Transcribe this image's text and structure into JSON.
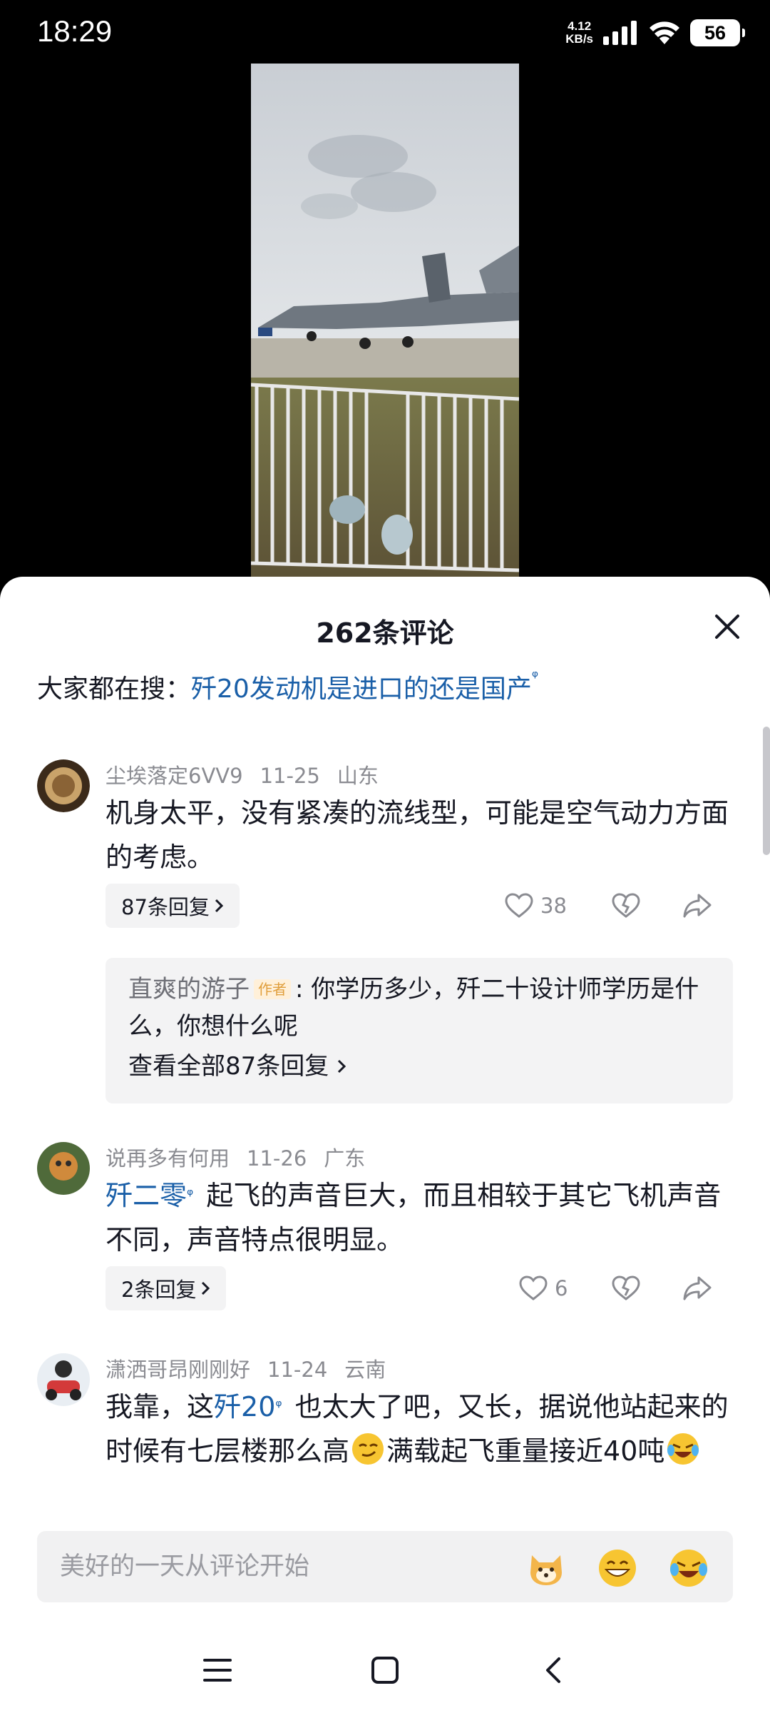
{
  "status_bar": {
    "time": "18:29",
    "net_speed_value": "4.12",
    "net_speed_unit": "KB/s",
    "battery": "56"
  },
  "sheet": {
    "title": "262条评论",
    "search_prefix": "大家都在搜：",
    "search_link": "歼20发动机是进口的还是国产"
  },
  "comments": [
    {
      "username": "尘埃落定6VV9",
      "date": "11-25",
      "location": "山东",
      "text": "机身太平，没有紧凑的流线型，可能是空气动力方面的考虑。",
      "replies_label": "87条回复",
      "likes": "38",
      "preview": {
        "username": "直爽的游子",
        "author_tag": "作者",
        "text": ": 你学历多少，歼二十设计师学历是什么，你想什么呢",
        "view_all": "查看全部87条回复"
      }
    },
    {
      "username": "说再多有何用",
      "date": "11-26",
      "location": "广东",
      "link": "歼二零",
      "text": " 起飞的声音巨大，而且相较于其它飞机声音不同，声音特点很明显。",
      "replies_label": "2条回复",
      "likes": "6"
    },
    {
      "username": "潇洒哥昂刚刚好",
      "date": "11-24",
      "location": "云南",
      "text_a": "我靠，这",
      "link": "歼20",
      "text_b": " 也太大了吧，又长，据说他站起来的时候有七层楼那么高",
      "text_c": "满载起飞重量接近40吨"
    }
  ],
  "input": {
    "placeholder": "美好的一天从评论开始"
  },
  "icons": {
    "close": "close-icon",
    "like": "heart-icon",
    "dislike": "broken-heart-icon",
    "share": "share-icon",
    "search_sup": "search-icon"
  },
  "colors": {
    "link": "#1a5fa8",
    "meta": "#8a8b91",
    "author_tag_bg": "#fff0d9",
    "author_tag_fg": "#e09e3b"
  }
}
